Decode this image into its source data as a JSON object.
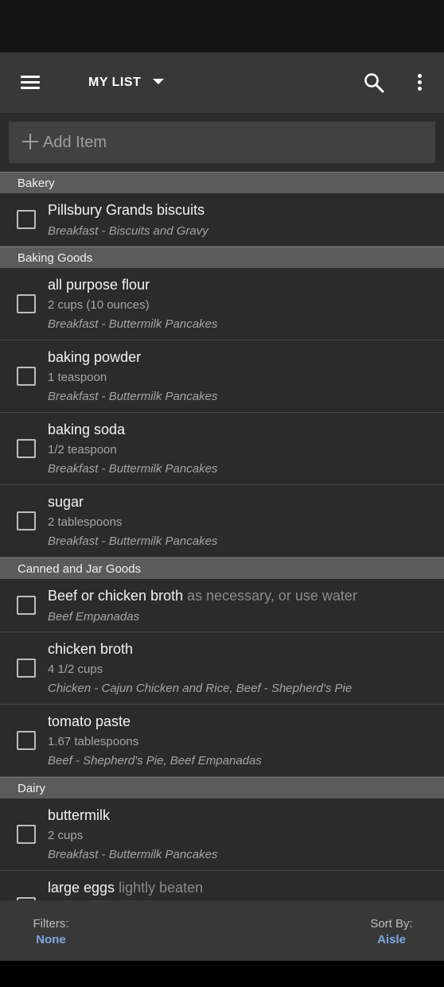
{
  "toolbar": {
    "list_title": "MY LIST",
    "icons": {
      "menu": "menu-icon",
      "dropdown": "dropdown-arrow-icon",
      "search": "search-icon",
      "more": "more-vert-icon"
    }
  },
  "add_item": {
    "placeholder": "Add Item",
    "icon": "plus-icon"
  },
  "sections": [
    {
      "name": "Bakery",
      "items": [
        {
          "name": "Pillsbury Grands biscuits",
          "note": "",
          "qty": "",
          "recipe": "Breakfast - Biscuits and Gravy"
        }
      ]
    },
    {
      "name": "Baking Goods",
      "items": [
        {
          "name": "all purpose flour",
          "note": "",
          "qty": "2 cups (10 ounces)",
          "recipe": "Breakfast - Buttermilk Pancakes"
        },
        {
          "name": "baking powder",
          "note": "",
          "qty": "1 teaspoon",
          "recipe": "Breakfast - Buttermilk Pancakes"
        },
        {
          "name": "baking soda",
          "note": "",
          "qty": "1/2 teaspoon",
          "recipe": "Breakfast - Buttermilk Pancakes"
        },
        {
          "name": "sugar",
          "note": "",
          "qty": "2 tablespoons",
          "recipe": "Breakfast - Buttermilk Pancakes"
        }
      ]
    },
    {
      "name": "Canned and Jar Goods",
      "items": [
        {
          "name": "Beef or chicken broth",
          "note": "as necessary, or use water",
          "qty": "",
          "recipe": "Beef Empanadas"
        },
        {
          "name": "chicken broth",
          "note": "",
          "qty": "4 1/2 cups",
          "recipe": "Chicken - Cajun Chicken and Rice, Beef - Shepherd's Pie"
        },
        {
          "name": "tomato paste",
          "note": "",
          "qty": "1.67 tablespoons",
          "recipe": "Beef - Shepherd's Pie, Beef Empanadas"
        }
      ]
    },
    {
      "name": "Dairy",
      "items": [
        {
          "name": "buttermilk",
          "note": "",
          "qty": "2 cups",
          "recipe": "Breakfast - Buttermilk Pancakes"
        },
        {
          "name": "large eggs",
          "note": "lightly beaten",
          "qty": "",
          "recipe": ""
        }
      ]
    }
  ],
  "bottom_bar": {
    "filters_label": "Filters:",
    "filters_value": "None",
    "sort_label": "Sort By:",
    "sort_value": "Aisle"
  },
  "colors": {
    "toolbar_bg": "#383838",
    "list_bg": "#2b2b2b",
    "section_header_bg": "#5b5b5b",
    "accent_link": "#7fa7df"
  }
}
